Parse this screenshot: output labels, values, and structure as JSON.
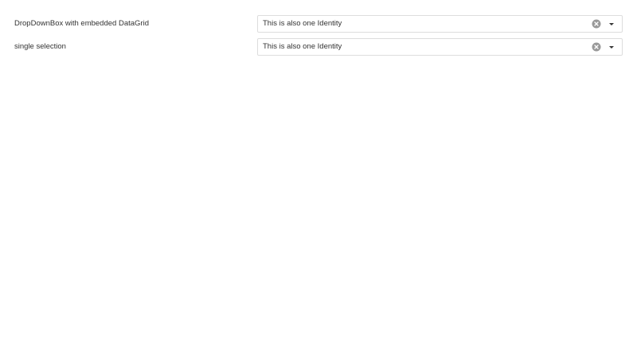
{
  "fields": [
    {
      "label": "DropDownBox with embedded DataGrid",
      "value": "This is also one Identity",
      "clear_icon": "clear-circle-x",
      "dropdown_icon": "caret-down"
    },
    {
      "label": "single selection",
      "value": "This is also one Identity",
      "clear_icon": "clear-circle-x",
      "dropdown_icon": "caret-down"
    }
  ],
  "colors": {
    "text": "#333333",
    "border": "#dddddd",
    "icon": "#999999",
    "background": "#ffffff"
  }
}
